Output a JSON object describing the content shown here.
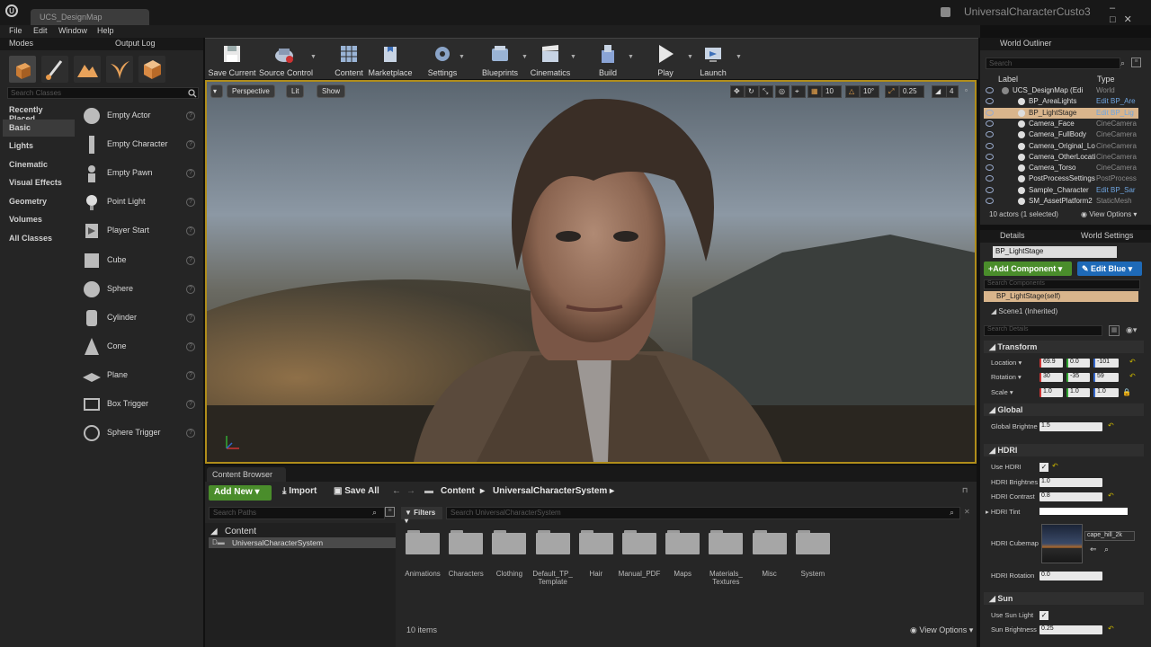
{
  "window": {
    "doc_tab": "UCS_DesignMap",
    "project_title": "UniversalCharacterCusto3",
    "controls": "–□✕"
  },
  "menu": [
    "File",
    "Edit",
    "Window",
    "Help"
  ],
  "left_panel": {
    "tabs": [
      "Modes",
      "Output Log"
    ],
    "search_placeholder": "Search Classes",
    "categories": [
      "Recently Placed",
      "Basic",
      "Lights",
      "Cinematic",
      "Visual Effects",
      "Geometry",
      "Volumes",
      "All Classes"
    ],
    "selected_category": "Basic",
    "classes": [
      "Empty Actor",
      "Empty Character",
      "Empty Pawn",
      "Point Light",
      "Player Start",
      "Cube",
      "Sphere",
      "Cylinder",
      "Cone",
      "Plane",
      "Box Trigger",
      "Sphere Trigger"
    ],
    "help_glyph": "?"
  },
  "toolbar": {
    "buttons": [
      "Save Current",
      "Source Control",
      "Content",
      "Marketplace",
      "Settings",
      "Blueprints",
      "Cinematics",
      "Build",
      "Play",
      "Launch"
    ]
  },
  "viewport": {
    "perspective": "Perspective",
    "lit": "Lit",
    "show": "Show",
    "grid_snap": "10",
    "rot_snap": "10°",
    "scale_snap": "0.25",
    "camera_speed": "4"
  },
  "content_browser": {
    "tab": "Content Browser",
    "add_new": "Add New",
    "import": "Import",
    "save_all": "Save All",
    "breadcrumb": [
      "Content",
      "UniversalCharacterSystem"
    ],
    "search_paths_placeholder": "Search Paths",
    "tree_root": "Content",
    "tree_child": "UniversalCharacterSystem",
    "filters": "Filters",
    "search_placeholder": "Search UniversalCharacterSystem",
    "folders": [
      "Animations",
      "Characters",
      "Clothing",
      "Default_TP_\nTemplate",
      "Hair",
      "Manual_PDF",
      "Maps",
      "Materials_\nTextures",
      "Misc",
      "System"
    ],
    "items_count": "10 items",
    "view_options": "View Options"
  },
  "world_outliner": {
    "tab": "World Outliner",
    "search_placeholder": "Search",
    "col_label": "Label",
    "col_type": "Type",
    "rows": [
      {
        "label": "UCS_DesignMap (Editor)",
        "type": "World",
        "link": false
      },
      {
        "label": "BP_AreaLights",
        "type": "Edit BP_Are",
        "link": true
      },
      {
        "label": "BP_LightStage",
        "type": "Edit BP_Lig",
        "link": true
      },
      {
        "label": "Camera_Face",
        "type": "CineCamera",
        "link": false
      },
      {
        "label": "Camera_FullBody",
        "type": "CineCamera",
        "link": false
      },
      {
        "label": "Camera_Original_Lo",
        "type": "CineCamera",
        "link": false
      },
      {
        "label": "Camera_OtherLocati",
        "type": "CineCamera",
        "link": false
      },
      {
        "label": "Camera_Torso",
        "type": "CineCamera",
        "link": false
      },
      {
        "label": "PostProcessSettings",
        "type": "PostProcess",
        "link": false
      },
      {
        "label": "Sample_Character",
        "type": "Edit BP_Sar",
        "link": true
      },
      {
        "label": "SM_AssetPlatform2",
        "type": "StaticMesh",
        "link": false
      }
    ],
    "selected_row": "BP_LightStage",
    "count": "10 actors (1 selected)",
    "view_options": "View Options"
  },
  "details": {
    "tabs": [
      "Details",
      "World Settings"
    ],
    "actor_name": "BP_LightStage",
    "add_component": "+Add Component",
    "edit_blueprint": "Edit Blue",
    "search_components": "Search Components",
    "component_self": "BP_LightStage(self)",
    "component_scene": "Scene1 (Inherited)",
    "search_details": "Search Details",
    "transform": {
      "header": "Transform",
      "location_label": "Location",
      "location": [
        "69.9",
        "0.0",
        "-101"
      ],
      "rotation_label": "Rotation",
      "rotation": [
        "30",
        "-35",
        "59"
      ],
      "scale_label": "Scale",
      "scale": [
        "1.0",
        "1.0",
        "1.0"
      ]
    },
    "global": {
      "header": "Global",
      "brightness_label": "Global Brightne",
      "brightness": "1.5"
    },
    "hdri": {
      "header": "HDRI",
      "use_label": "Use HDRI",
      "brightness_label": "HDRI Brightnes",
      "brightness": "1.0",
      "contrast_label": "HDRI Contrast",
      "contrast": "0.8",
      "tint_label": "HDRI Tint",
      "cubemap_label": "HDRI Cubemap",
      "cubemap": "cape_hill_2k",
      "rotation_label": "HDRI Rotation",
      "rotation": "0.0"
    },
    "sun": {
      "header": "Sun",
      "use_label": "Use Sun Light",
      "brightness_label": "Sun Brightness",
      "brightness": "0.25"
    }
  },
  "colors": {
    "accent_green": "#4a8d2b",
    "accent_blue": "#1e6ab8",
    "selection": "#d9b58c",
    "viewport_border": "#b08d1a"
  }
}
